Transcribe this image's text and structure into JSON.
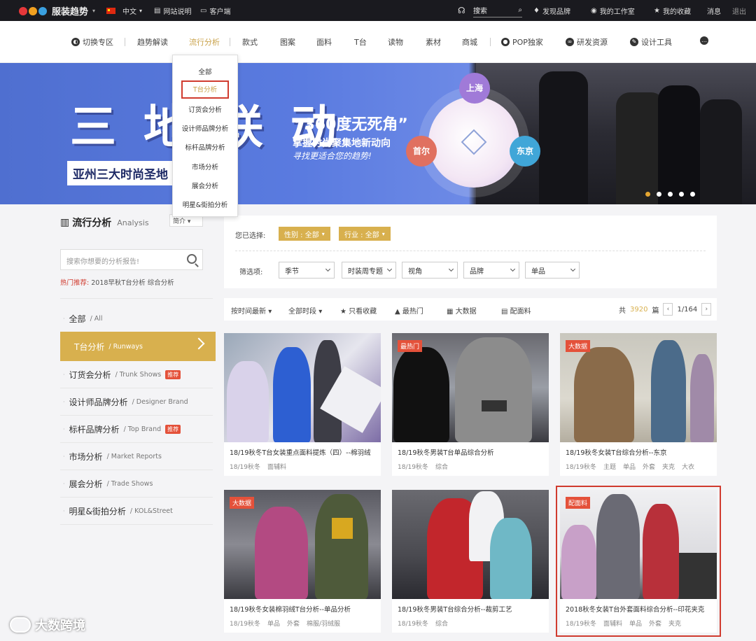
{
  "topbar": {
    "logo_text": "POP",
    "logo_cn": "服装趋势",
    "language": "中文",
    "site_intro": "网站说明",
    "client": "客户端",
    "search_label": "搜索",
    "discover": "发现品牌",
    "workspace": "我的工作室",
    "favorites": "我的收藏",
    "messages": "消息",
    "logout": "退出"
  },
  "nav": {
    "items": [
      "切换专区",
      "趋势解读",
      "流行分析",
      "款式",
      "图案",
      "面料",
      "T台",
      "读物",
      "素材",
      "商城",
      "POP独家",
      "研发资源",
      "设计工具"
    ]
  },
  "dropdown": {
    "items": [
      "全部",
      "T台分析",
      "订货会分析",
      "设计师品牌分析",
      "标杆品牌分析",
      "市场分析",
      "展会分析",
      "明星&街拍分析"
    ]
  },
  "banner": {
    "big_text": "三 地 联 动",
    "strip_text": "亚州三大时尚圣地   /东京",
    "quote": "“360度无死角”",
    "line2": "掌握时尚聚集地新动向",
    "line3": "寻找更适合您的趋势!",
    "city_shanghai": "上海",
    "city_seoul": "首尔",
    "city_tokyo": "东京"
  },
  "sidebar": {
    "title": "流行分析",
    "title_en": "Analysis",
    "sort_value": "简介",
    "search_placeholder": "搜索你想要的分析报告!",
    "hot_label": "热门推荐:",
    "hot_links": "2018早秋T台分析  综合分析",
    "items": [
      {
        "cn": "全部",
        "en": "/ All",
        "badge": ""
      },
      {
        "cn": "T台分析",
        "en": "/ Runways",
        "badge": ""
      },
      {
        "cn": "订货会分析",
        "en": "/ Trunk Shows",
        "badge": "推荐"
      },
      {
        "cn": "设计师品牌分析",
        "en": "/ Designer Brand",
        "badge": ""
      },
      {
        "cn": "标杆品牌分析",
        "en": "/ Top Brand",
        "badge": "推荐"
      },
      {
        "cn": "市场分析",
        "en": "/ Market Reports",
        "badge": ""
      },
      {
        "cn": "展会分析",
        "en": "/ Trade Shows",
        "badge": ""
      },
      {
        "cn": "明星&街拍分析",
        "en": "/ KOL&Street",
        "badge": ""
      }
    ]
  },
  "filter": {
    "selected_label": "您已选择:",
    "tag1": "性别 : 全部",
    "tag2": "行业 : 全部",
    "options_label": "筛选项:",
    "selects": [
      "季节",
      "时装周专题",
      "视角",
      "品牌",
      "单品"
    ]
  },
  "toolbar": {
    "sort": "按时间最新",
    "period": "全部时段",
    "only_fav": "只看收藏",
    "hottest": "最热门",
    "big_data": "大数据",
    "fabric": "配面料",
    "total_prefix": "共",
    "total": "3920",
    "total_suffix": "篇",
    "page": "1/164"
  },
  "cards": [
    {
      "tag": "",
      "title": "18/19秋冬T台女装重点面料提炼（四）--棉羽绒",
      "tags": [
        "18/19秋冬",
        "面辅料"
      ]
    },
    {
      "tag": "最热门",
      "title": "18/19秋冬男装T台单品综合分析",
      "tags": [
        "18/19秋冬",
        "综合"
      ]
    },
    {
      "tag": "大数据",
      "title": "18/19秋冬女装T台综合分析--东京",
      "tags": [
        "18/19秋冬",
        "主题",
        "单品",
        "外套",
        "夹克",
        "大衣"
      ]
    },
    {
      "tag": "大数据",
      "title": "18/19秋冬女装棉羽绒T台分析--单品分析",
      "tags": [
        "18/19秋冬",
        "单品",
        "外套",
        "棉服/羽绒服"
      ]
    },
    {
      "tag": "",
      "title": "18/19秋冬男装T台综合分析--裁剪工艺",
      "tags": [
        "18/19秋冬",
        "综合"
      ]
    },
    {
      "tag": "配面料",
      "title": "2018秋冬女装T台外套面料综合分析--印花夹克",
      "tags": [
        "18/19秋冬",
        "面辅料",
        "单品",
        "外套",
        "夹克"
      ]
    }
  ],
  "watermark": "大数跨境"
}
